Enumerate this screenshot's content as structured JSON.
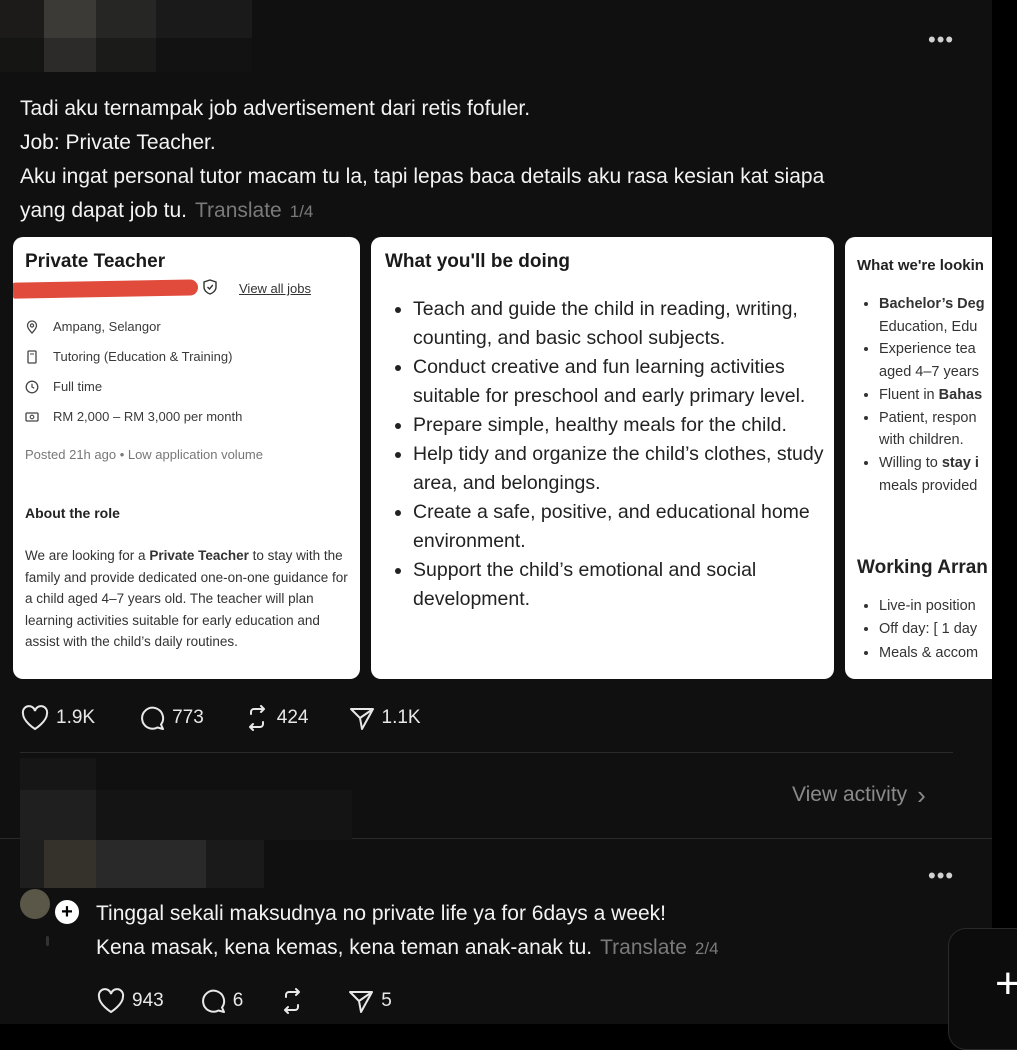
{
  "post": {
    "lines": [
      "Tadi aku ternampak job advertisement dari retis fofuler.",
      "Job: Private Teacher.",
      "Aku ingat personal tutor macam tu la, tapi lepas baca details aku rasa kesian kat siapa",
      "yang dapat job tu."
    ],
    "translate_label": "Translate",
    "page_indicator": "1/4",
    "stats": {
      "likes": "1.9K",
      "comments": "773",
      "reposts": "424",
      "shares": "1.1K"
    },
    "more_label": "•••"
  },
  "card1": {
    "title": "Private Teacher",
    "view_all": "View all jobs",
    "location": "Ampang, Selangor",
    "category": "Tutoring (Education & Training)",
    "job_type": "Full time",
    "salary": "RM 2,000 – RM 3,000 per month",
    "posted": "Posted 21h ago  •  Low application volume",
    "about_heading": "About the role",
    "about_pre": "We are looking for a ",
    "about_bold": "Private Teacher",
    "about_post": " to stay with the family and provide dedicated one-on-one guidance for a child aged 4–7 years old. The teacher will plan learning activities suitable for early education and assist with the child’s daily routines."
  },
  "card2": {
    "title": "What you'll be doing",
    "items": [
      "Teach and guide the child in reading, writing, counting, and basic school subjects.",
      "Conduct creative and fun learning activities suitable for preschool and early primary level.",
      "Prepare simple, healthy meals for the child.",
      "Help tidy and organize the child’s clothes, study area, and belongings.",
      "Create a safe, positive, and educational home environment.",
      "Support the child’s emotional and social development."
    ]
  },
  "card3": {
    "title": "What we're lookin",
    "items": [
      {
        "bold": "Bachelor’s Deg",
        "line2": "Education, Edu"
      },
      {
        "text": "Experience tea",
        "line2": "aged 4–7 years"
      },
      {
        "pre": "Fluent in ",
        "bold": "Bahas"
      },
      {
        "text": "Patient, respon",
        "line2": "with children."
      },
      {
        "pre": "Willing to ",
        "bold": "stay i",
        "line2": "meals provided"
      }
    ],
    "working_heading": "Working Arran",
    "working_items": [
      "Live-in position",
      "Off day: [ 1 day",
      "Meals & accom"
    ]
  },
  "activity": {
    "label": "View activity",
    "chevron": "›"
  },
  "reply": {
    "lines": [
      "Tinggal sekali maksudnya no private life ya for 6days a week!",
      "Kena masak, kena kemas, kena teman anak-anak tu."
    ],
    "translate_label": "Translate",
    "page_indicator": "2/4",
    "stats": {
      "likes": "943",
      "comments": "6",
      "shares": "5"
    },
    "follow_symbol": "+",
    "more_label": "•••"
  },
  "fab": {
    "symbol": "+"
  }
}
